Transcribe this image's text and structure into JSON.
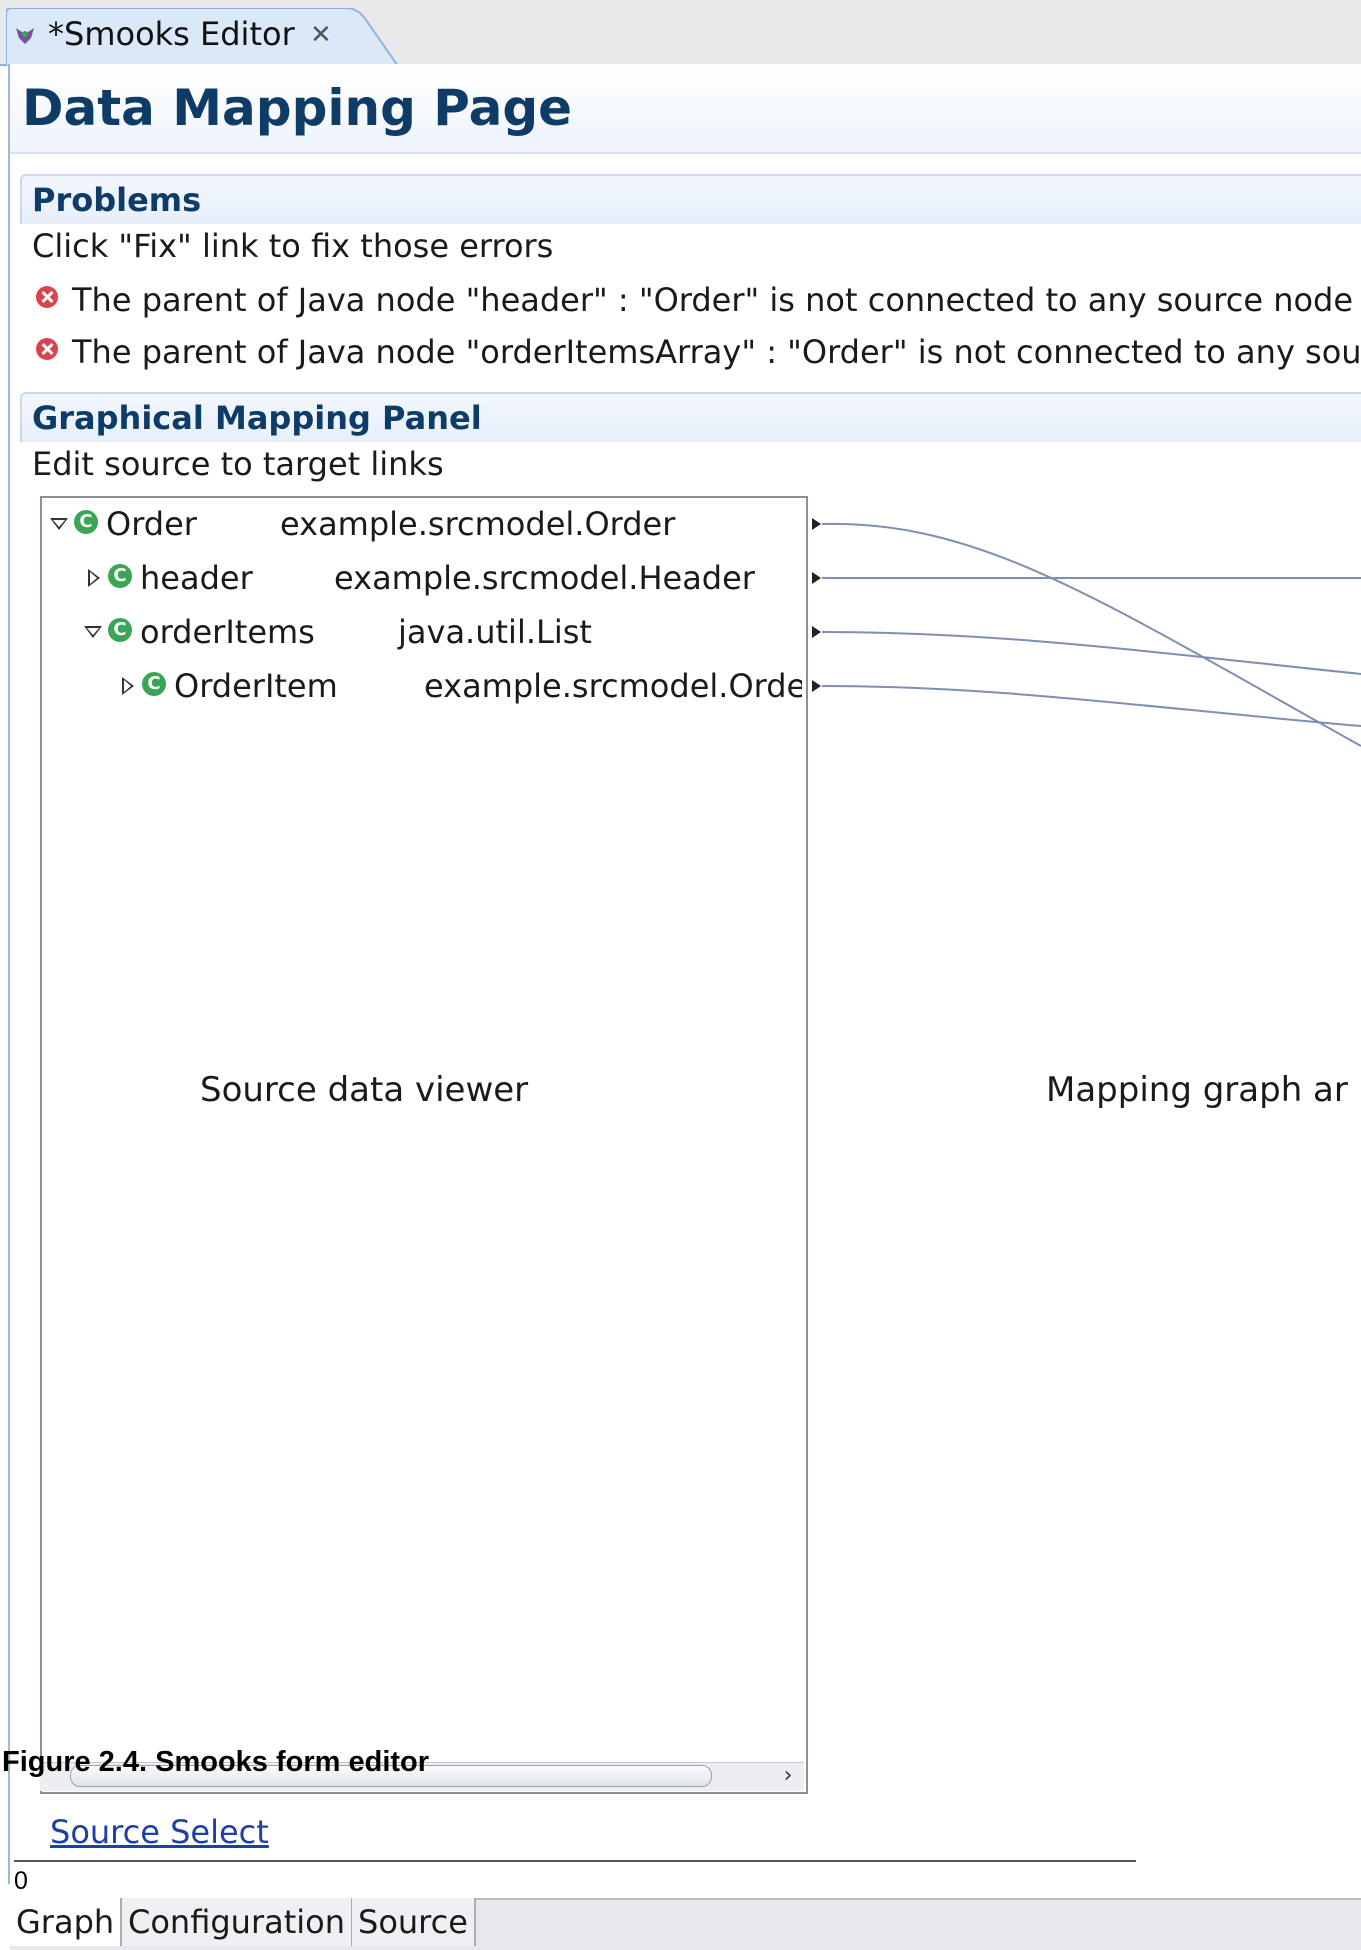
{
  "editor_tab": {
    "title": "*Smooks Editor",
    "close_icon": "close-icon",
    "app_icon": "smooks-editor-icon"
  },
  "page": {
    "title": "Data Mapping Page"
  },
  "problems": {
    "title": "Problems",
    "description": "Click \"Fix\" link to fix those errors",
    "errors": [
      {
        "icon": "error-icon",
        "text": "The parent of Java node \"header\" : \"Order\" is not connected to any source node"
      },
      {
        "icon": "error-icon",
        "text": "The parent of Java node \"orderItemsArray\" : \"Order\" is not connected to any sour"
      }
    ]
  },
  "graphical_panel": {
    "title": "Graphical Mapping Panel",
    "description": "Edit source to target links",
    "source_tree": [
      {
        "name": "Order",
        "type": "example.srcmodel.Order",
        "expanded": true,
        "depth": 0
      },
      {
        "name": "header",
        "type": "example.srcmodel.Header",
        "expanded": false,
        "depth": 1
      },
      {
        "name": "orderItems",
        "type": "java.util.List",
        "expanded": true,
        "depth": 1
      },
      {
        "name": "OrderItem",
        "type": "example.srcmodel.Order",
        "expanded": false,
        "depth": 2
      }
    ],
    "source_viewer_label": "Source data viewer",
    "mapping_graph_label": "Mapping graph ar",
    "link_color": "#7f8fb3"
  },
  "figure_caption": "Figure 2.4. Smooks form editor",
  "source_select_link": "Source Select",
  "page_number": "0",
  "bottom_tabs": [
    {
      "label": "Graph",
      "active": true
    },
    {
      "label": "Configuration",
      "active": false
    },
    {
      "label": "Source",
      "active": false
    }
  ],
  "colors": {
    "heading": "#0f3b67",
    "error": "#d9434e",
    "class_icon": "#3aa655",
    "link": "#1f3fa8"
  }
}
